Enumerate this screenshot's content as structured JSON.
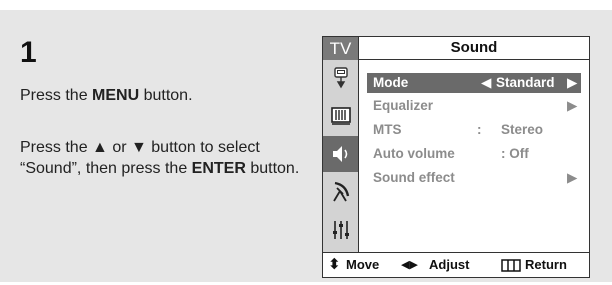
{
  "step": {
    "number": "1"
  },
  "instructions": {
    "line1_pre": "Press the ",
    "line1_bold": "MENU",
    "line1_post": " button.",
    "line2_pre": "Press the ▲ or ▼ button to select “Sound”, then press the ",
    "line2_bold": "ENTER",
    "line2_post": " button."
  },
  "osd": {
    "sidebar_title": "TV",
    "sidebar_icons": [
      "input-icon",
      "picture-icon",
      "sound-icon",
      "channel-icon",
      "setup-icon"
    ],
    "active_icon": "sound-icon",
    "title": "Sound",
    "rows": [
      {
        "label": "Mode",
        "value": "Standard",
        "left_arrow": "◀",
        "right_arrow": "▶",
        "selected": true
      },
      {
        "label": "Equalizer",
        "value": "",
        "right_arrow": "▶"
      },
      {
        "label": "MTS",
        "sep": ":",
        "value": "Stereo"
      },
      {
        "label": "Auto volume",
        "value": ": Off"
      },
      {
        "label": "Sound effect",
        "value": "",
        "right_arrow": "▶"
      }
    ],
    "footer": {
      "move_icon": "⬍",
      "move": "Move",
      "adjust_icon": "◀▶",
      "adjust": "Adjust",
      "return": "Return"
    },
    "colors": {
      "selected_bg": "#6a6a6a",
      "inactive_text": "#8c8c8c",
      "sidebar_bg": "#d3d3d3"
    }
  }
}
